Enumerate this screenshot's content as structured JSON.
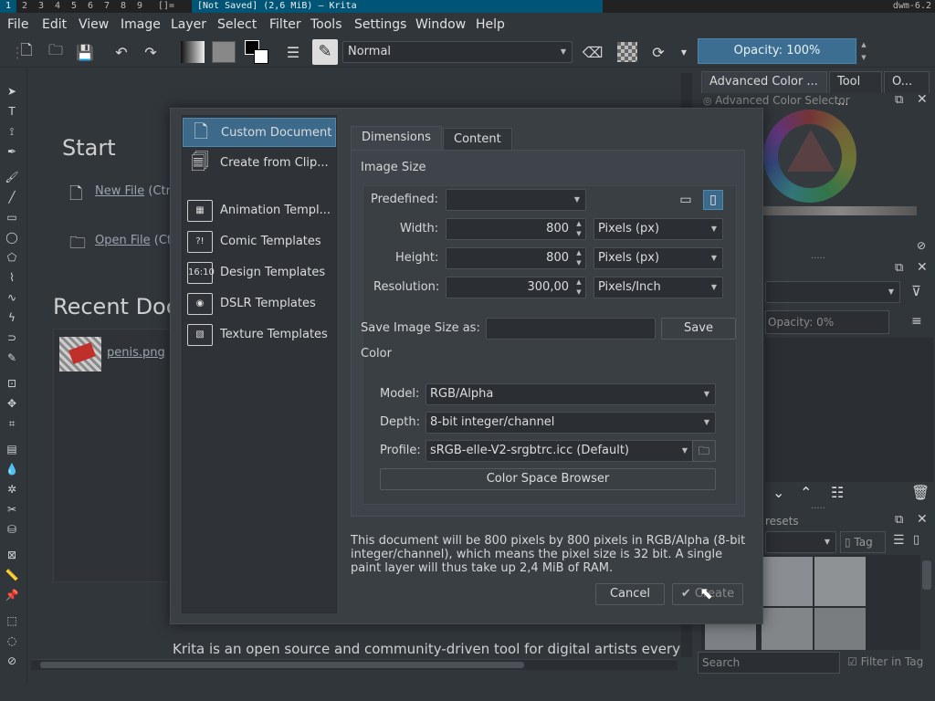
{
  "dwm": {
    "tags": [
      "1",
      "2",
      "3",
      "4",
      "5",
      "6",
      "7",
      "8",
      "9"
    ],
    "layout": "[]=",
    "window_title": "[Not Saved]  (2,6 MiB)  – Krita",
    "status": "dwm-6.2"
  },
  "menu": [
    "File",
    "Edit",
    "View",
    "Image",
    "Layer",
    "Select",
    "Filter",
    "Tools",
    "Settings",
    "Window",
    "Help"
  ],
  "toolbar": {
    "blend_mode": "Normal",
    "opacity_label": "Opacity: 100%"
  },
  "welcome": {
    "start_heading": "Start",
    "new_file": "New File",
    "new_file_shortcut": "(Ctr",
    "open_file": "Open File",
    "open_file_shortcut": "(Ct",
    "recent_heading": "Recent Doc",
    "recent_file": "penis.png",
    "footer_text": "Krita is an open source and community-driven tool for digital artists every"
  },
  "dock": {
    "tabs": [
      "Advanced Color ...",
      "Tool ...",
      "O..."
    ],
    "color_selector_title": "Advanced Color Selector",
    "opacity_label": "Opacity:  0%",
    "presets_label": "resets",
    "tag_label": "Tag",
    "search_placeholder": "Search",
    "filter_in_tag": "Filter in Tag"
  },
  "dialog": {
    "templates": [
      {
        "label": "Custom Document",
        "icon": "document-icon",
        "selected": true
      },
      {
        "label": "Create from Clip...",
        "icon": "clipboard-icon",
        "selected": false
      },
      {
        "label": "Animation Templ...",
        "icon": "film-icon",
        "selected": false
      },
      {
        "label": "Comic Templates",
        "icon": "comic-icon",
        "selected": false
      },
      {
        "label": "Design Templates",
        "icon": "design-icon",
        "selected": false
      },
      {
        "label": "DSLR Templates",
        "icon": "camera-icon",
        "selected": false
      },
      {
        "label": "Texture Templates",
        "icon": "texture-icon",
        "selected": false
      }
    ],
    "tabs": [
      "Dimensions",
      "Content"
    ],
    "image_size_heading": "Image Size",
    "predefined_label": "Predefined:",
    "predefined_value": "",
    "width_label": "Width:",
    "width_value": "800",
    "width_unit": "Pixels (px)",
    "height_label": "Height:",
    "height_value": "800",
    "height_unit": "Pixels (px)",
    "resolution_label": "Resolution:",
    "resolution_value": "300,00",
    "resolution_unit": "Pixels/Inch",
    "save_size_label": "Save Image Size as:",
    "save_button": "Save",
    "color_heading": "Color",
    "model_label": "Model:",
    "model_value": "RGB/Alpha",
    "depth_label": "Depth:",
    "depth_value": "8-bit integer/channel",
    "profile_label": "Profile:",
    "profile_value": "sRGB-elle-V2-srgbtrc.icc (Default)",
    "color_space_browser": "Color Space Browser",
    "info_text": "This document will be 800 pixels by 800 pixels in RGB/Alpha (8-bit integer/channel), which means the pixel size is 32 bit. A single paint layer will thus take up 2,4 MiB of RAM.",
    "cancel_button": "Cancel",
    "create_button": "Create"
  },
  "colors": {
    "accent": "#3d6a8a",
    "background": "#31363b"
  }
}
